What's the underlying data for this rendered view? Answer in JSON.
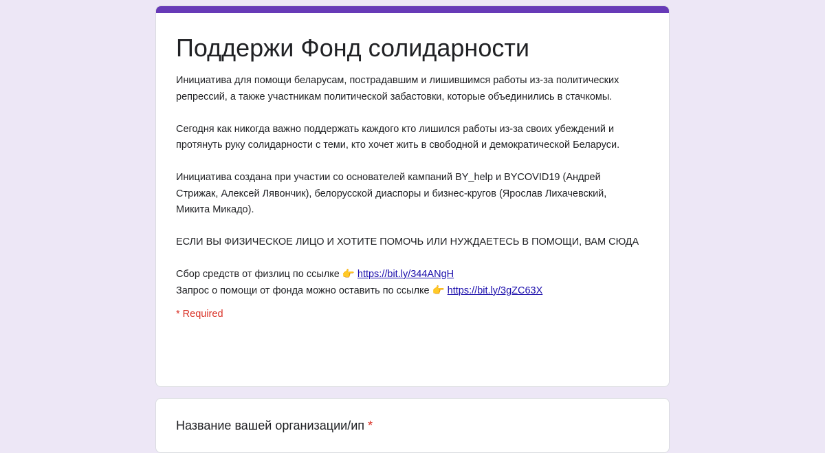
{
  "form": {
    "title": "Поддержи Фонд солидарности",
    "description": {
      "p1": "Инициатива для помощи беларусам, пострадавшим и лишившимся работы из-за политических репрессий, а также участникам политической забастовки, которые объединились в стачкомы.",
      "p2": "Сегодня как никогда важно поддержать каждого кто лишился работы из-за своих убеждений и протянуть руку солидарности с теми, кто хочет жить в свободной и демократической Беларуси.",
      "p3": "Инициатива создана при участии со основателей кампаний BY_help и BYCOVID19 (Андрей Стрижак, Алексей Лявончик), белорусской диаспоры и бизнес-кругов (Ярослав Лихачевский, Микита Микадо).",
      "p4": "ЕСЛИ ВЫ ФИЗИЧЕСКОЕ ЛИЦО И ХОТИТЕ ПОМОЧЬ ИЛИ НУЖДАЕТЕСЬ В ПОМОЩИ, ВАМ СЮДА",
      "link1_text": "Сбор средств от физлиц по ссылке",
      "link1_emoji": "👉",
      "link1_url": "https://bit.ly/344ANgH",
      "link2_text": "Запрос о помощи от фонда можно оставить по ссылке",
      "link2_emoji": "👉",
      "link2_url": "https://bit.ly/3gZC63X"
    },
    "required_note": "* Required",
    "accent_color": "#673ab7",
    "background_color": "#ede7f6"
  },
  "question": {
    "title": "Название вашей организации/ип",
    "required_marker": "*"
  }
}
